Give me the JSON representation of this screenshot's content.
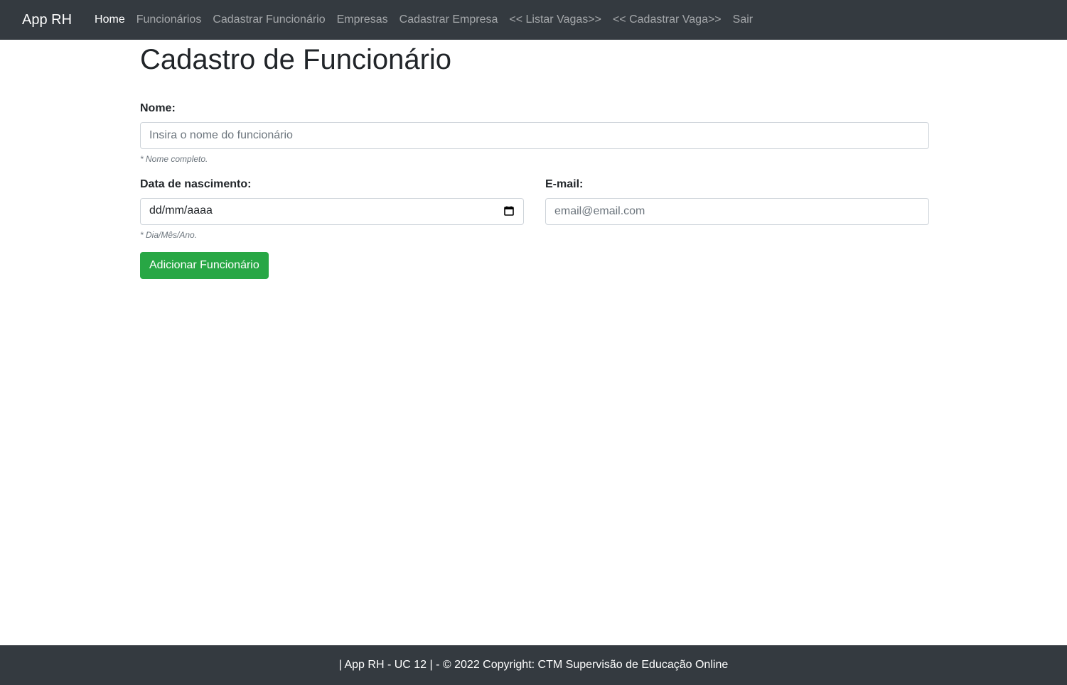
{
  "navbar": {
    "brand": "App RH",
    "links": [
      {
        "label": "Home",
        "active": true
      },
      {
        "label": "Funcionários"
      },
      {
        "label": "Cadastrar Funcionário"
      },
      {
        "label": "Empresas"
      },
      {
        "label": "Cadastrar Empresa"
      },
      {
        "label": "<< Listar Vagas>>"
      },
      {
        "label": "<< Cadastrar Vaga>>"
      },
      {
        "label": "Sair"
      }
    ]
  },
  "page": {
    "title": "Cadastro de Funcionário"
  },
  "form": {
    "nome": {
      "label": "Nome:",
      "placeholder": "Insira o nome do funcionário",
      "help": "* Nome completo."
    },
    "nascimento": {
      "label": "Data de nascimento:",
      "display": "dd/mm/aaaa",
      "help": "* Dia/Mês/Ano.",
      "icon": "calendar-icon"
    },
    "email": {
      "label": "E-mail:",
      "placeholder": "email@email.com"
    },
    "submit_label": "Adicionar Funcionário"
  },
  "footer": {
    "text": "| App RH - UC 12 | - © 2022 Copyright: CTM Supervisão de Educação Online"
  },
  "colors": {
    "navbar_bg": "#343a40",
    "button_bg": "#28a745"
  }
}
